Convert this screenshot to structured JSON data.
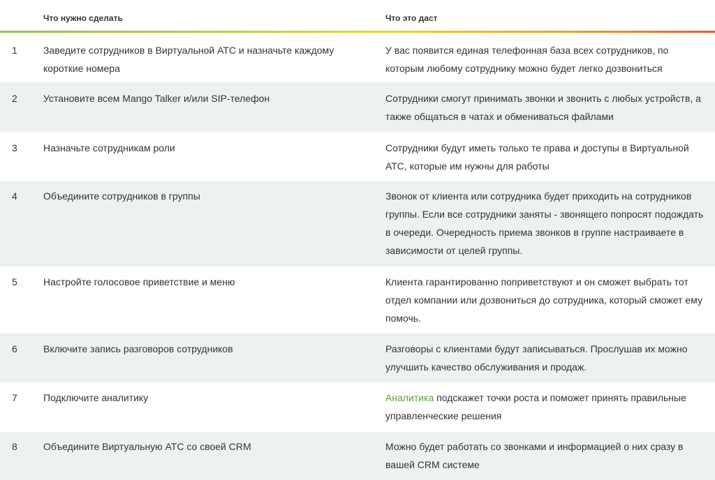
{
  "header": {
    "col_task": "Что нужно сделать",
    "col_result": "Что это даст"
  },
  "colors": {
    "row_alt": "#eef1f2",
    "link": "#5a9e3c",
    "gradient_start": "#8fc63f",
    "gradient_end": "#ef5a24"
  },
  "rows": [
    {
      "num": "1",
      "task": "Заведите сотрудников в Виртуальной АТС и назначьте каждому короткие номера",
      "result": "У вас появится единая телефонная база всех сотрудников, по которым любому сотруднику можно будет легко дозвониться"
    },
    {
      "num": "2",
      "task": "Установите всем Mango Talker и/или SIP-телефон",
      "result": "Сотрудники смогут принимать звонки и звонить с любых устройств, а также общаться в чатах и обмениваться файлами"
    },
    {
      "num": "3",
      "task": "Назначьте сотрудникам роли",
      "result": "Сотрудники будут иметь только те права и доступы в Виртуальной АТС, которые им нужны для работы"
    },
    {
      "num": "4",
      "task": "Объедините сотрудников в группы",
      "result": "Звонок от клиента или сотрудника будет приходить на сотрудников группы. Если все сотрудники заняты - звонящего попросят подождать в очереди. Очередность приема звонков в группе настраиваете в зависимости от целей группы."
    },
    {
      "num": "5",
      "task": "Настройте голосовое приветствие и меню",
      "result": "Клиента гарантированно поприветствуют и он сможет выбрать тот отдел компании или дозвониться до сотрудника, который сможет ему помочь."
    },
    {
      "num": "6",
      "task": "Включите запись разговоров сотрудников",
      "result": "Разговоры с клиентами будут записываться. Прослушав их можно улучшить качество обслуживания и продаж."
    },
    {
      "num": "7",
      "task": "Подключите аналитику",
      "result_link": "Аналитика",
      "result_rest": " подскажет точки роста и поможет принять правильные управленческие решения"
    },
    {
      "num": "8",
      "task": "Объедините Виртуальную АТС со своей CRM",
      "result": "Можно будет работать со звонками и информацией о них сразу в вашей CRM системе"
    }
  ]
}
